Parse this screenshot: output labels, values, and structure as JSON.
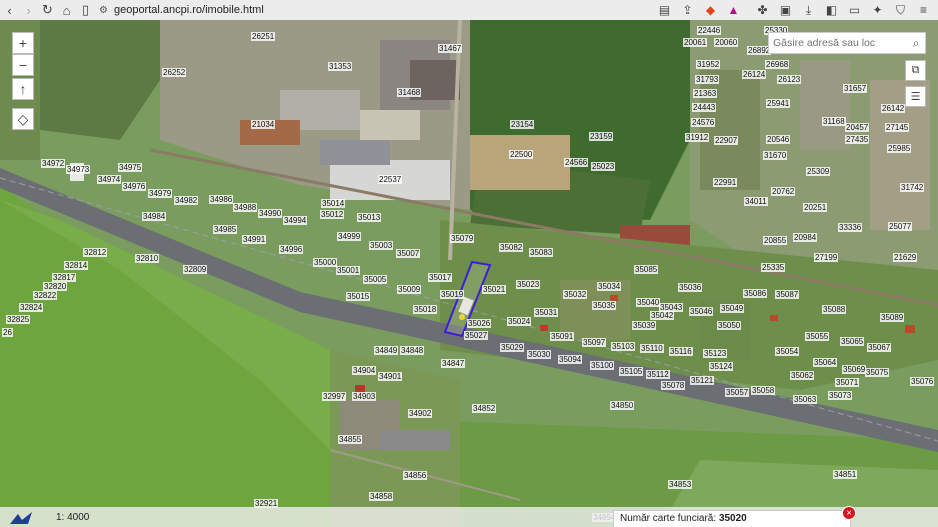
{
  "browser": {
    "url": "geoportal.ancpi.ro/imobile.html",
    "nav_icons": [
      "back-icon",
      "forward-icon",
      "reload-icon",
      "home-icon",
      "bookmark-icon"
    ],
    "right_icons": [
      "reader-icon",
      "share-icon",
      "brave-shield-icon",
      "brave-rewards-icon",
      "extensions-icon",
      "screenshot-icon",
      "download-icon",
      "sidebar-icon",
      "wallet-icon",
      "leo-icon",
      "vpn-icon",
      "menu-icon"
    ]
  },
  "map": {
    "search_placeholder": "Găsire adresă sau loc",
    "zoom_in": "+",
    "zoom_out": "−",
    "north": "↑",
    "locate": "◇",
    "scale": "1: 4000",
    "parcels": [
      {
        "id": "26251"
      },
      {
        "id": "31467"
      },
      {
        "id": "20061"
      },
      {
        "id": "20060"
      },
      {
        "id": "22446"
      },
      {
        "id": "26892"
      },
      {
        "id": "25330"
      },
      {
        "id": "31353"
      },
      {
        "id": "31468"
      },
      {
        "id": "26252"
      },
      {
        "id": "31952"
      },
      {
        "id": "26968"
      },
      {
        "id": "26124"
      },
      {
        "id": "26123"
      },
      {
        "id": "31793"
      },
      {
        "id": "31657"
      },
      {
        "id": "21363"
      },
      {
        "id": "25941"
      },
      {
        "id": "24443"
      },
      {
        "id": "26142"
      },
      {
        "id": "24576"
      },
      {
        "id": "31168"
      },
      {
        "id": "20457"
      },
      {
        "id": "27145"
      },
      {
        "id": "21034"
      },
      {
        "id": "23154"
      },
      {
        "id": "23159"
      },
      {
        "id": "31912"
      },
      {
        "id": "22907"
      },
      {
        "id": "20546"
      },
      {
        "id": "27435"
      },
      {
        "id": "22500"
      },
      {
        "id": "24566"
      },
      {
        "id": "25023"
      },
      {
        "id": "31670"
      },
      {
        "id": "25985"
      },
      {
        "id": "34972"
      },
      {
        "id": "34973"
      },
      {
        "id": "34975"
      },
      {
        "id": "22537"
      },
      {
        "id": "25309"
      },
      {
        "id": "34974"
      },
      {
        "id": "34976"
      },
      {
        "id": "34979"
      },
      {
        "id": "22991"
      },
      {
        "id": "31742"
      },
      {
        "id": "34986"
      },
      {
        "id": "34982"
      },
      {
        "id": "34988"
      },
      {
        "id": "35014"
      },
      {
        "id": "20762"
      },
      {
        "id": "34011"
      },
      {
        "id": "34990"
      },
      {
        "id": "35012"
      },
      {
        "id": "35013"
      },
      {
        "id": "20251"
      },
      {
        "id": "34984"
      },
      {
        "id": "34994"
      },
      {
        "id": "34985"
      },
      {
        "id": "34999"
      },
      {
        "id": "33336"
      },
      {
        "id": "25077"
      },
      {
        "id": "34991"
      },
      {
        "id": "35079"
      },
      {
        "id": "20855"
      },
      {
        "id": "20984"
      },
      {
        "id": "35003"
      },
      {
        "id": "35082"
      },
      {
        "id": "35083"
      },
      {
        "id": "32812"
      },
      {
        "id": "34996"
      },
      {
        "id": "35007"
      },
      {
        "id": "27199"
      },
      {
        "id": "21629"
      },
      {
        "id": "32810"
      },
      {
        "id": "35000"
      },
      {
        "id": "25335"
      },
      {
        "id": "32814"
      },
      {
        "id": "32809"
      },
      {
        "id": "35001"
      },
      {
        "id": "35085"
      },
      {
        "id": "35017"
      },
      {
        "id": "32817"
      },
      {
        "id": "35005"
      },
      {
        "id": "35023"
      },
      {
        "id": "32820"
      },
      {
        "id": "35009"
      },
      {
        "id": "35021"
      },
      {
        "id": "35034"
      },
      {
        "id": "35036"
      },
      {
        "id": "32822"
      },
      {
        "id": "35015"
      },
      {
        "id": "35019"
      },
      {
        "id": "35032"
      },
      {
        "id": "35086"
      },
      {
        "id": "35087"
      },
      {
        "id": "32824"
      },
      {
        "id": "35035"
      },
      {
        "id": "35040"
      },
      {
        "id": "35043"
      },
      {
        "id": "35049"
      },
      {
        "id": "35088"
      },
      {
        "id": "35018"
      },
      {
        "id": "35031"
      },
      {
        "id": "35046"
      },
      {
        "id": "35042"
      },
      {
        "id": "35089"
      },
      {
        "id": "32825"
      },
      {
        "id": "35024"
      },
      {
        "id": "35026"
      },
      {
        "id": "35039"
      },
      {
        "id": "35050"
      },
      {
        "id": "35027"
      },
      {
        "id": "35091"
      },
      {
        "id": "35097"
      },
      {
        "id": "35055"
      },
      {
        "id": "35065"
      },
      {
        "id": "35029"
      },
      {
        "id": "35103"
      },
      {
        "id": "35110"
      },
      {
        "id": "35116"
      },
      {
        "id": "35054"
      },
      {
        "id": "35067"
      },
      {
        "id": "34849"
      },
      {
        "id": "34848"
      },
      {
        "id": "35030"
      },
      {
        "id": "35123"
      },
      {
        "id": "34847"
      },
      {
        "id": "35094"
      },
      {
        "id": "35100"
      },
      {
        "id": "35124"
      },
      {
        "id": "35064"
      },
      {
        "id": "35105"
      },
      {
        "id": "35112"
      },
      {
        "id": "35069"
      },
      {
        "id": "35075"
      },
      {
        "id": "34904"
      },
      {
        "id": "34901"
      },
      {
        "id": "35062"
      },
      {
        "id": "35071"
      },
      {
        "id": "35076"
      },
      {
        "id": "35121"
      },
      {
        "id": "35078"
      },
      {
        "id": "35057"
      },
      {
        "id": "35058"
      },
      {
        "id": "32997"
      },
      {
        "id": "34903"
      },
      {
        "id": "35073"
      },
      {
        "id": "35063"
      },
      {
        "id": "34852"
      },
      {
        "id": "34850"
      },
      {
        "id": "34902"
      },
      {
        "id": "34855"
      },
      {
        "id": "34856"
      },
      {
        "id": "34851"
      },
      {
        "id": "34853"
      },
      {
        "id": "34858"
      },
      {
        "id": "32921"
      },
      {
        "id": "26"
      },
      {
        "id": "34854"
      }
    ]
  },
  "popup": {
    "label": "Număr carte funciară:",
    "value": "35020",
    "close": "×"
  },
  "colors": {
    "selection_outline": "#3b1fd6",
    "highway": "#6b6e73",
    "close_button": "#d8121b"
  }
}
